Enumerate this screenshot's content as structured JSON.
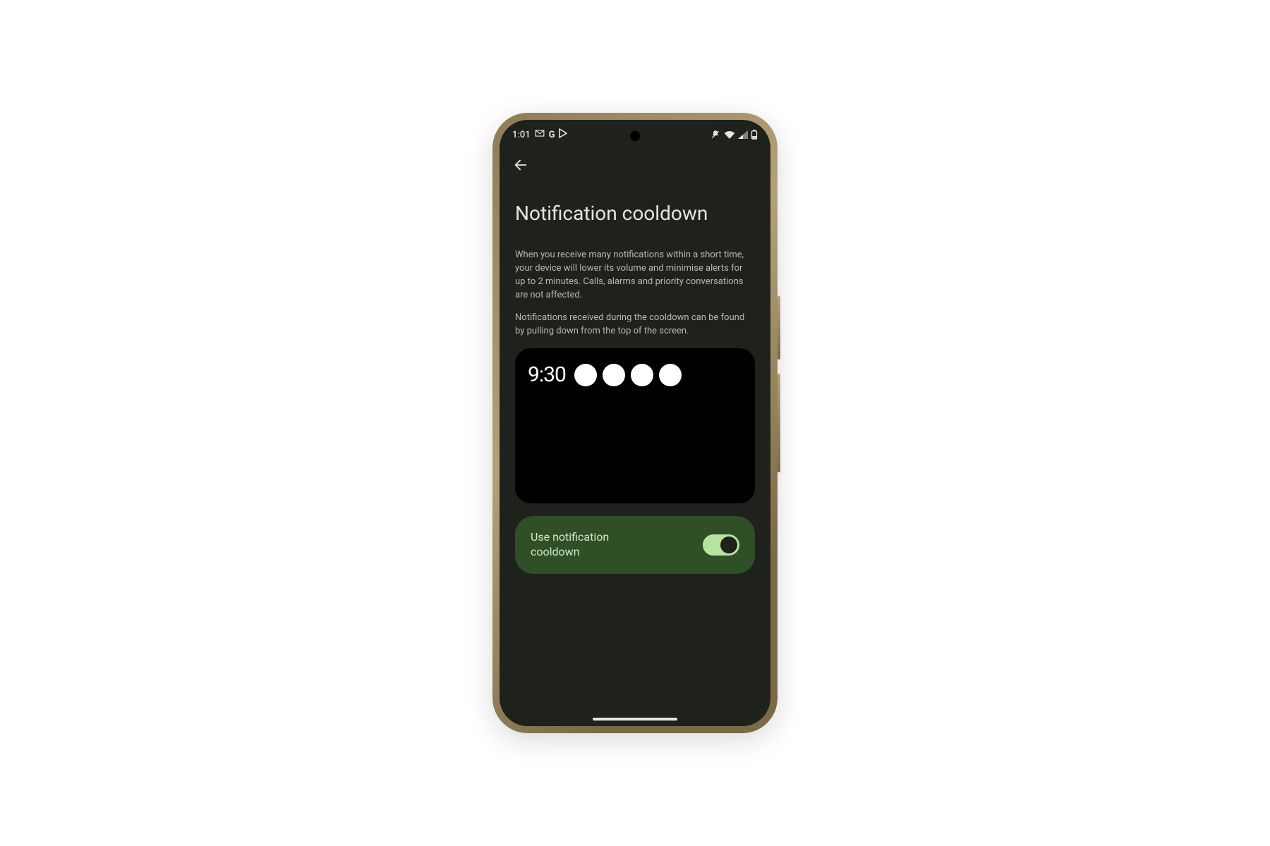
{
  "statusbar": {
    "time": "1:01",
    "left_icons": [
      "gmail-icon",
      "google-g-icon",
      "play-icon"
    ],
    "right_icons": [
      "vibrate-icon",
      "wifi-icon",
      "signal-icon",
      "battery-icon"
    ]
  },
  "page": {
    "title": "Notification cooldown",
    "description1": "When you receive many notifications within a short time, your device will lower its volume and minimise alerts for up to 2 minutes. Calls, alarms and priority conversations are not affected.",
    "description2": "Notifications received during the cooldown can be found by pulling down from the top of the screen."
  },
  "preview": {
    "time": "9:30",
    "dot_count": 4
  },
  "toggle": {
    "label": "Use notification cooldown",
    "enabled": true
  },
  "colors": {
    "screen_bg": "#1f211c",
    "toggle_card": "#2f4f27",
    "switch_track": "#b7e3a1"
  }
}
